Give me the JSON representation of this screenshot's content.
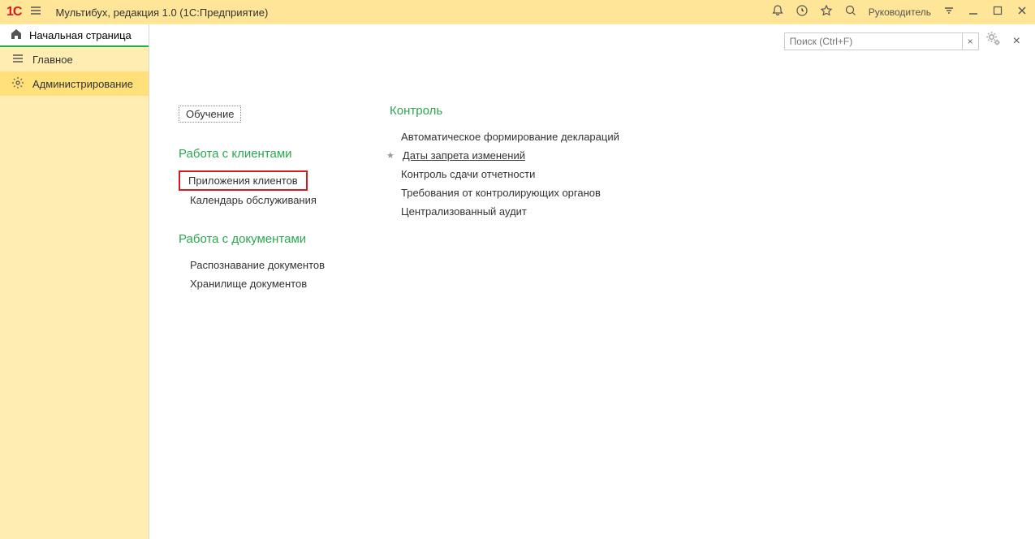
{
  "titlebar": {
    "app_title": "Мультибух, редакция 1.0  (1С:Предприятие)",
    "user_label": "Руководитель"
  },
  "sidebar": {
    "home_tab": "Начальная страница",
    "items": [
      {
        "label": "Главное"
      },
      {
        "label": "Администрирование"
      }
    ]
  },
  "content_toolbar": {
    "search_placeholder": "Поиск (Ctrl+F)"
  },
  "content": {
    "training_button": "Обучение",
    "col1": {
      "section1_title": "Работа с клиентами",
      "section1_links": [
        "Приложения клиентов",
        "Календарь обслуживания"
      ],
      "section2_title": "Работа с документами",
      "section2_links": [
        "Распознавание документов",
        "Хранилище документов"
      ]
    },
    "col2": {
      "section1_title": "Контроль",
      "section1_links": [
        "Автоматическое формирование деклараций",
        "Даты запрета изменений",
        "Контроль сдачи отчетности",
        "Требования от контролирующих органов",
        "Централизованный аудит"
      ]
    }
  }
}
